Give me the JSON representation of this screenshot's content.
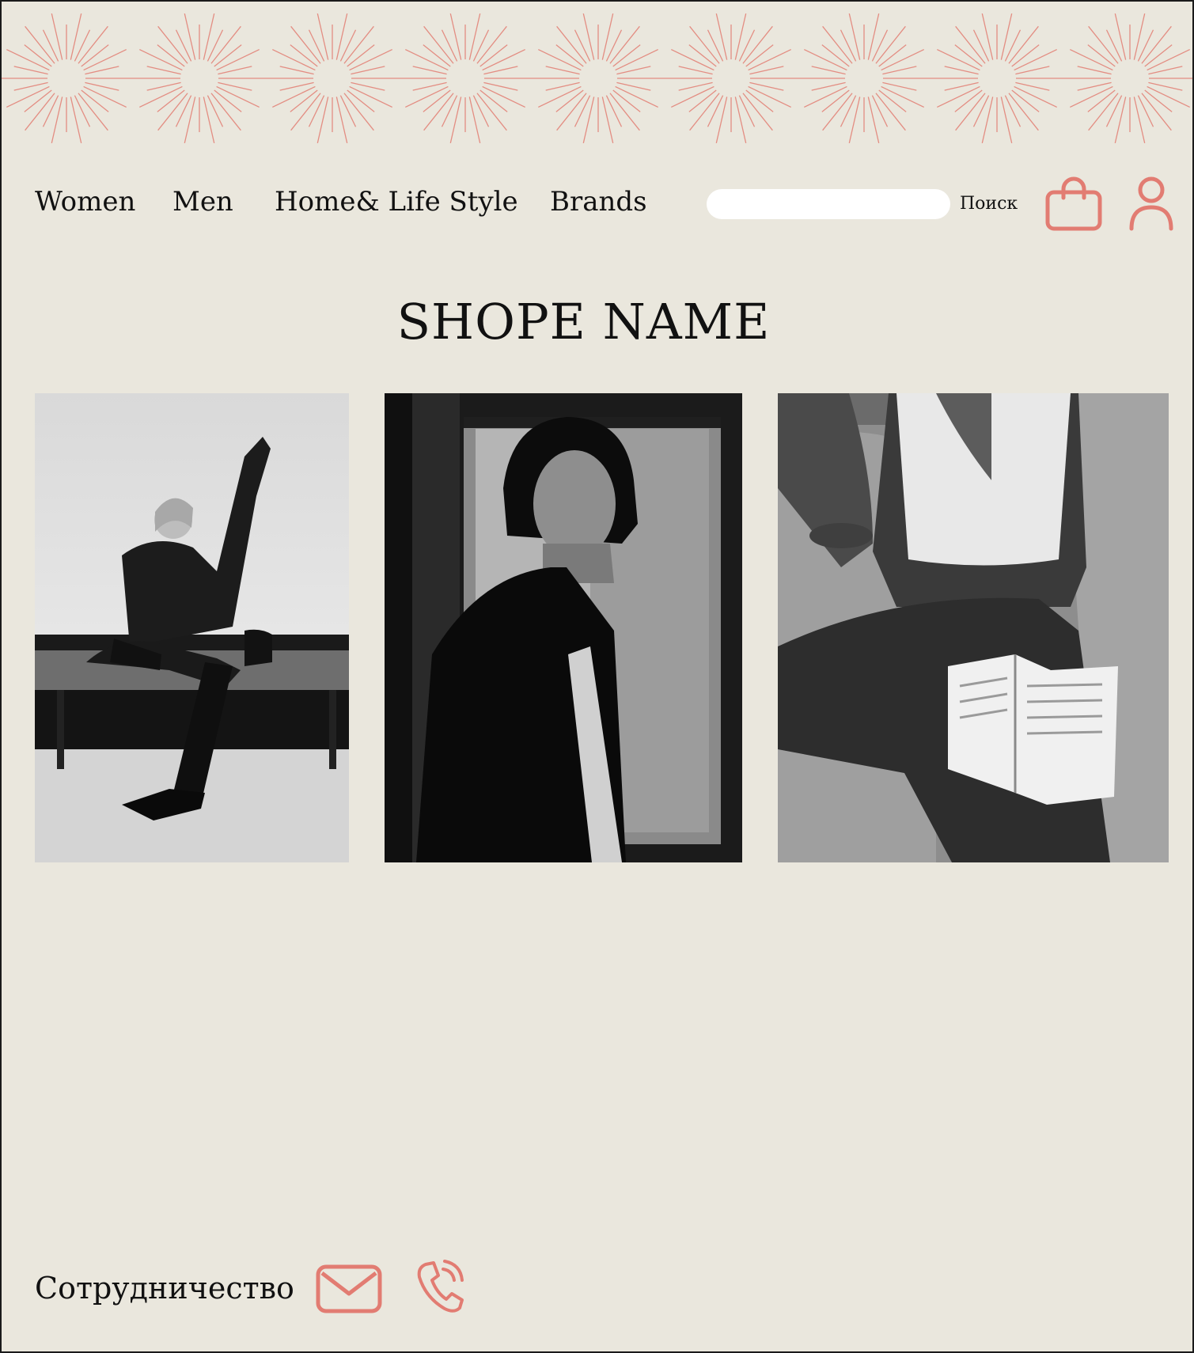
{
  "colors": {
    "background": "#eae7dd",
    "accent": "#e27c72",
    "text": "#111111",
    "search_field": "#ffffff"
  },
  "banner": {
    "pattern": "starburst-line-pattern",
    "burst_count": 9
  },
  "nav": {
    "items": [
      {
        "label": "Women"
      },
      {
        "label": "Men"
      },
      {
        "label": "Home& Life Style"
      },
      {
        "label": "Brands"
      }
    ]
  },
  "search": {
    "value": "",
    "placeholder": "",
    "button_label": "Поиск"
  },
  "header_icons": {
    "cart": "shopping-bag-icon",
    "account": "user-icon"
  },
  "shop": {
    "title": "SHOPE NAME"
  },
  "gallery": {
    "photos": [
      {
        "subject": "woman-on-bench-photo"
      },
      {
        "subject": "man-by-window-photo"
      },
      {
        "subject": "woman-reading-book-photo"
      }
    ]
  },
  "footer": {
    "cooperation_label": "Сотрудничество",
    "icons": [
      "mail-icon",
      "phone-icon"
    ]
  }
}
